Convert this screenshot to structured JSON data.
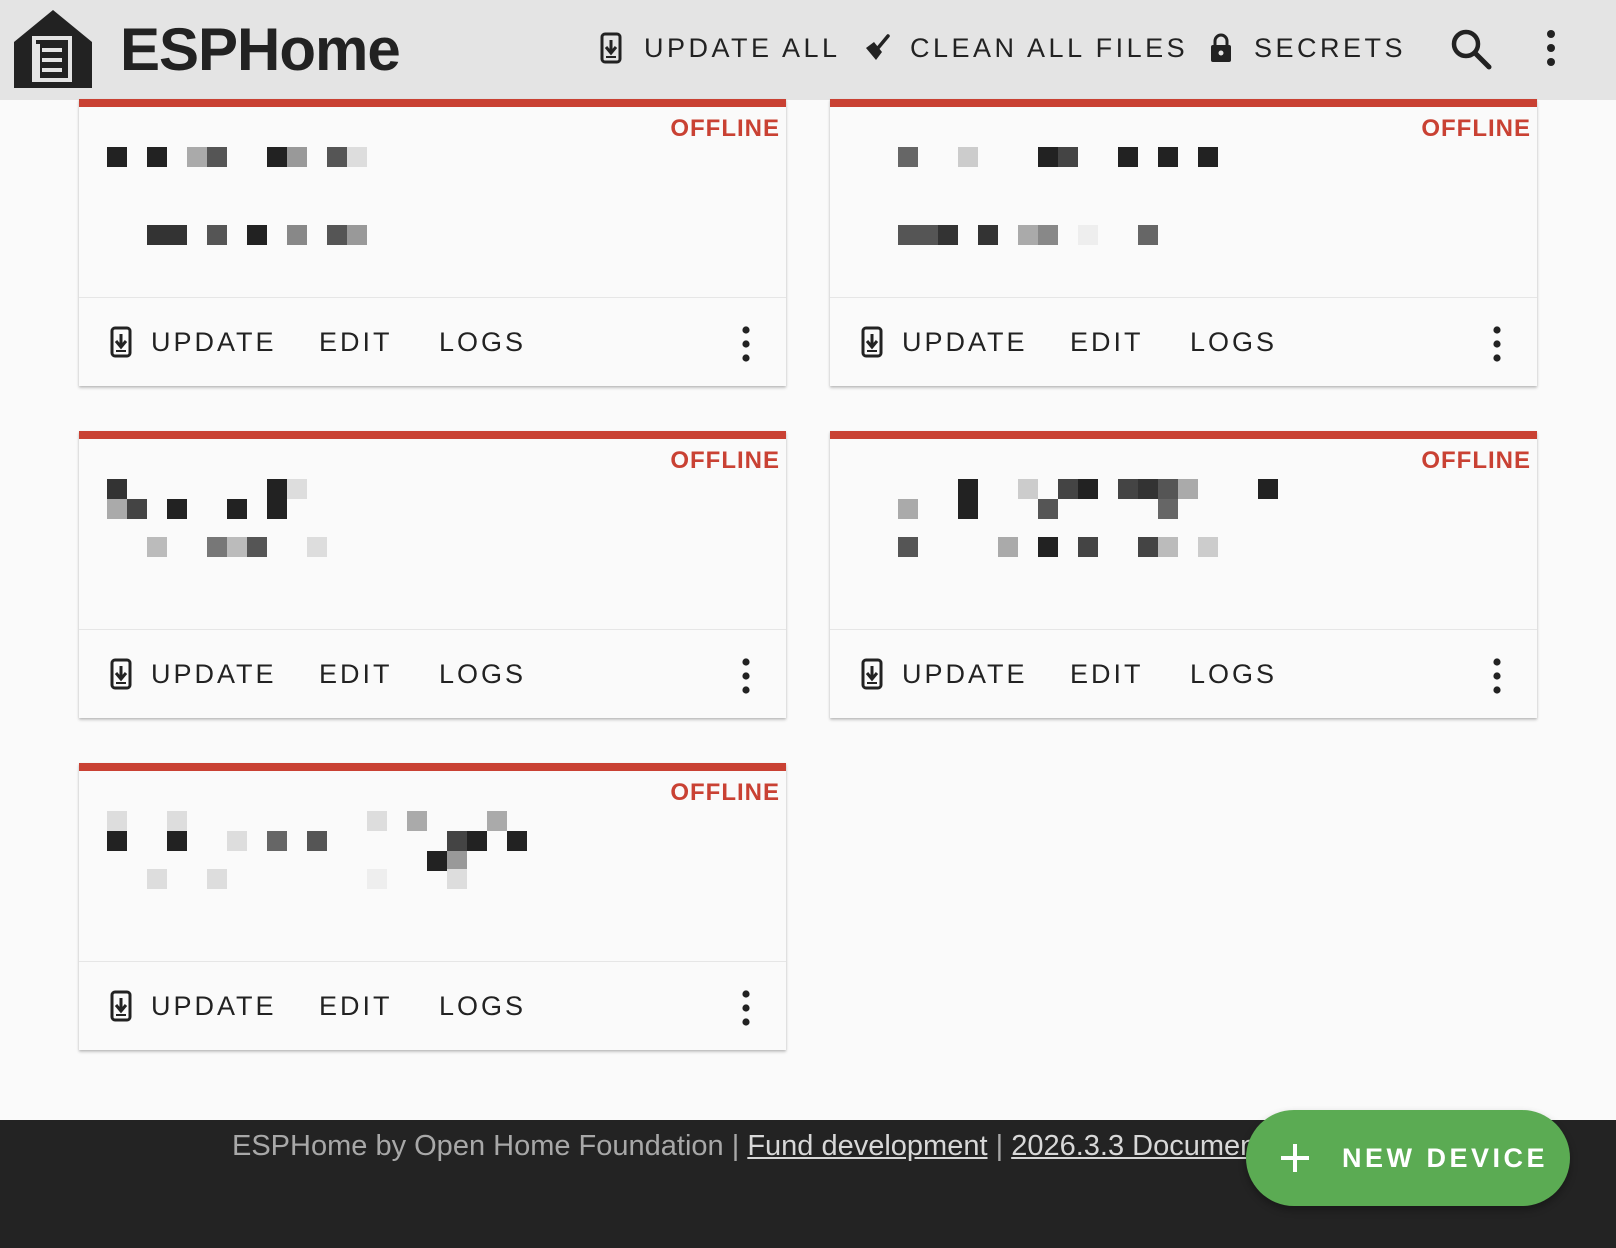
{
  "header": {
    "title": "ESPHome",
    "update_all": "UPDATE ALL",
    "clean_all": "CLEAN ALL FILES",
    "secrets": "SECRETS"
  },
  "device_actions": {
    "update": "UPDATE",
    "edit": "EDIT",
    "logs": "LOGS"
  },
  "devices": [
    {
      "status": "OFFLINE",
      "name": "",
      "comment": ""
    },
    {
      "status": "OFFLINE",
      "name": "",
      "comment": ""
    },
    {
      "status": "OFFLINE",
      "name": "",
      "comment": ""
    },
    {
      "status": "OFFLINE",
      "name": "",
      "comment": ""
    },
    {
      "status": "OFFLINE",
      "name": "",
      "comment": ""
    }
  ],
  "footer": {
    "prefix": "ESPHome by Open Home Foundation | ",
    "fund_link": "Fund development",
    "separator": " | ",
    "version_link": "2026.3.3 Documentation"
  },
  "fab": {
    "label": "NEW DEVICE"
  },
  "colors": {
    "offline": "#c94133",
    "fab": "#5bab53",
    "header_bg": "#e4e4e4",
    "footer_bg": "#232323"
  }
}
